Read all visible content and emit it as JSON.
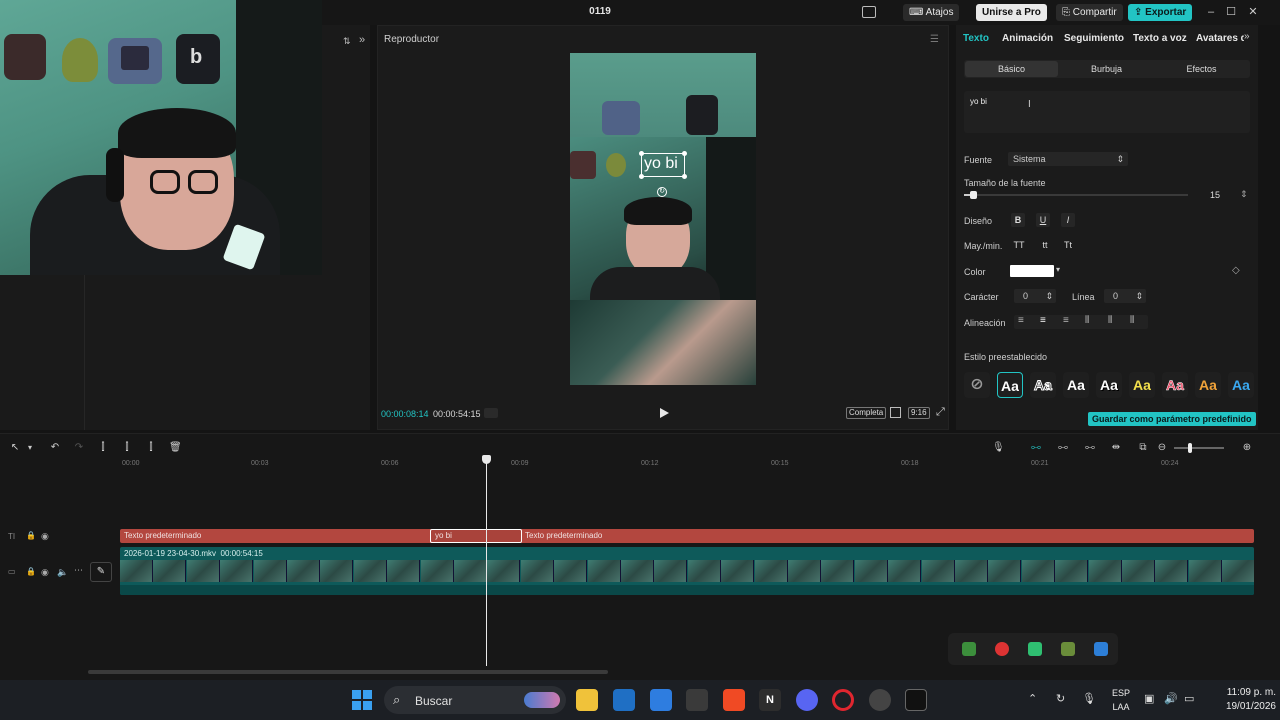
{
  "window": {
    "title": "0119",
    "shortcuts_label": "Atajos",
    "join_pro_label": "Unirse a Pro",
    "share_label": "Compartir",
    "export_label": "Exportar"
  },
  "player": {
    "label": "Reproductor",
    "current_time": "00:00:08:14",
    "total_time": "00:00:54:15",
    "fit_label": "Completa",
    "ratio_label": "9:16",
    "overlay_text": "yo bi"
  },
  "right_panel": {
    "tabs": [
      "Texto",
      "Animación",
      "Seguimiento",
      "Texto a voz",
      "Avatares de IA"
    ],
    "subtabs": [
      "Básico",
      "Burbuja",
      "Efectos"
    ],
    "text_value": "yo bi",
    "font_label": "Fuente",
    "font_value": "Sistema",
    "size_label": "Tamaño de la fuente",
    "size_value": "15",
    "design_label": "Diseño",
    "design_buttons": [
      "B",
      "U",
      "I"
    ],
    "case_label": "May./min.",
    "case_buttons": [
      "TT",
      "tt",
      "Tt"
    ],
    "color_label": "Color",
    "color_value": "#ffffff",
    "char_label": "Carácter",
    "char_value": "0",
    "line_label": "Línea",
    "line_value": "0",
    "align_label": "Alineación",
    "preset_label": "Estilo preestablecido",
    "preset_glyph": "Aa",
    "save_preset_label": "Guardar como parámetro predefinido"
  },
  "timeline": {
    "ruler": [
      "00:00",
      "00:03",
      "00:06",
      "00:09",
      "00:12",
      "00:15",
      "00:18",
      "00:21",
      "00:24"
    ],
    "text_segments": [
      "Texto predeterminado",
      "yo bi",
      "Texto predeterminado"
    ],
    "video_label": "2026-01-19 23-04-30.mkv",
    "video_duration": "00:00:54:15"
  },
  "taskbar": {
    "search_label": "Buscar",
    "lang_top": "ESP",
    "lang_bottom": "LAA",
    "time": "11:09 p. m.",
    "date": "19/01/2026"
  },
  "colors": {
    "accent": "#22c4c4",
    "text_track": "#b3473f",
    "video_track": "#0e5a5a"
  }
}
